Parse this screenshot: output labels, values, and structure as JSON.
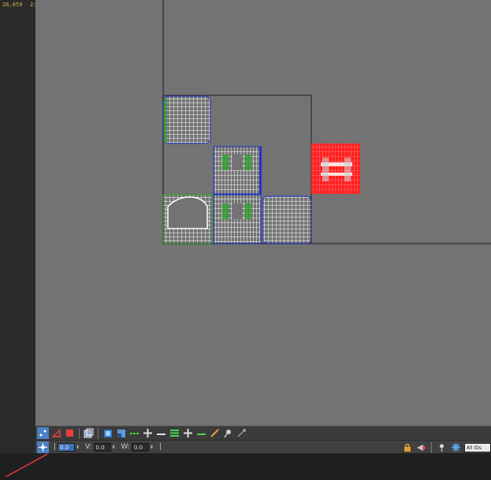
{
  "status": {
    "ruler_value": "26,059",
    "ruler_value2": "2:"
  },
  "fields": {
    "u_value": "0.0",
    "v_label": "V:",
    "v_value": "0.0",
    "w_label": "W:",
    "w_value": "0.0"
  },
  "filter": {
    "selected": "All IDs"
  },
  "icons": {
    "toolbar": [
      "select-vertex-icon",
      "select-edge-icon",
      "select-face-icon",
      "element-icon",
      "show-map-icon",
      "display-icon",
      "align-h-icon",
      "move-cross-icon",
      "line-h-icon",
      "stack-icon",
      "move-cross2-icon",
      "line-h2-icon",
      "paint-icon",
      "pin-icon",
      "brush-icon"
    ],
    "status_right": [
      "lock-icon",
      "pan-icon",
      "light-icon",
      "snowflake-icon"
    ]
  },
  "colors": {
    "viewport_bg": "#737373",
    "selected": "#ff2020",
    "wire_white": "#ffffff",
    "wire_green": "#2aa52a",
    "wire_blue": "#2233cc"
  }
}
